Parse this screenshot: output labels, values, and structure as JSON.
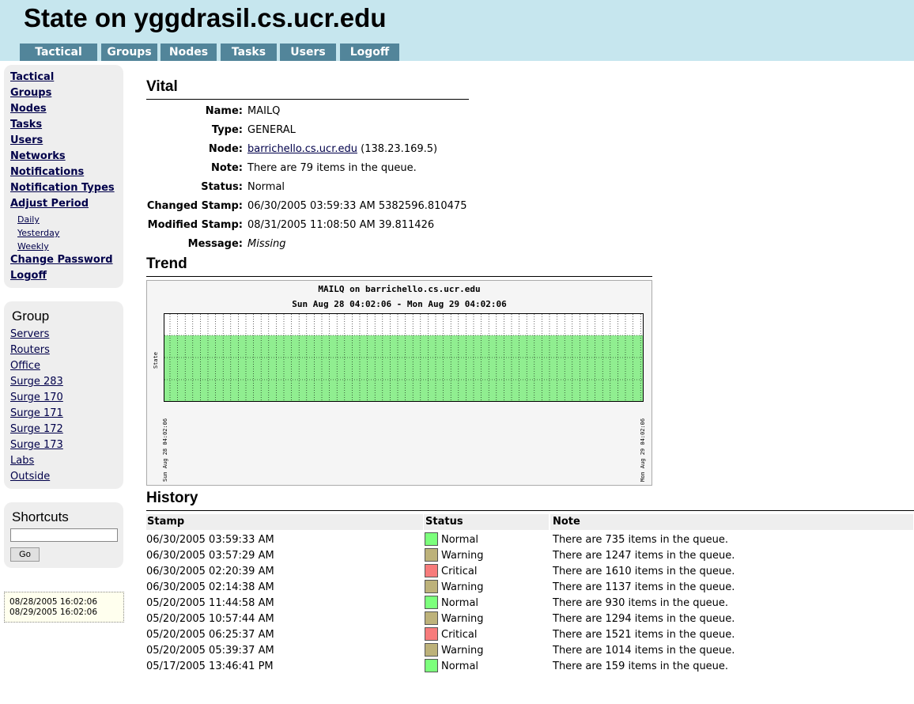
{
  "header": {
    "title": "State on yggdrasil.cs.ucr.edu",
    "tabs": [
      "Tactical",
      "Groups",
      "Nodes",
      "Tasks",
      "Users",
      "Logoff"
    ]
  },
  "sidebar": {
    "nav": [
      "Tactical",
      "Groups",
      "Nodes",
      "Tasks",
      "Users",
      "Networks",
      "Notifications",
      "Notification Types",
      "Adjust Period"
    ],
    "period": [
      "Daily",
      "Yesterday",
      "Weekly"
    ],
    "nav_bottom": [
      "Change Password",
      "Logoff"
    ],
    "group_title": "Group",
    "groups": [
      "Servers",
      "Routers",
      "Office",
      "Surge 283",
      "Surge 170",
      "Surge 171",
      "Surge 172",
      "Surge 173",
      "Labs",
      "Outside"
    ],
    "shortcuts_title": "Shortcuts",
    "shortcut_value": "",
    "go_label": "Go",
    "range_start": "08/28/2005 16:02:06",
    "range_end": "08/29/2005 16:02:06"
  },
  "vital": {
    "title": "Vital",
    "labels": [
      "Name:",
      "Type:",
      "Node:",
      "Note:",
      "Status:",
      "Changed Stamp:",
      "Modified Stamp:",
      "Message:"
    ],
    "name": "MAILQ",
    "type": "GENERAL",
    "node_link": "barrichello.cs.ucr.edu",
    "node_ip": "(138.23.169.5)",
    "note": "There are 79 items in the queue.",
    "status": "Normal",
    "changed": "06/30/2005 03:59:33 AM 5382596.810475",
    "modified": "08/31/2005 11:08:50 AM 39.811426",
    "message": "Missing"
  },
  "trend": {
    "title": "Trend",
    "chart_title": "MAILQ on barrichello.cs.ucr.edu",
    "chart_range": "Sun Aug 28 04:02:06 - Mon Aug 29 04:02:06",
    "ylabel": "State",
    "x_start": "Sun Aug 28 04:02:06",
    "x_end": "Mon Aug 29 04:02:06",
    "fill_color": "#90ee90",
    "state_fraction": 0.75
  },
  "history": {
    "title": "History",
    "columns": [
      "Stamp",
      "Status",
      "Note"
    ],
    "rows": [
      {
        "stamp": "06/30/2005 03:59:33 AM",
        "status": "Normal",
        "note": "There are 735 items in the queue."
      },
      {
        "stamp": "06/30/2005 03:57:29 AM",
        "status": "Warning",
        "note": "There are 1247 items in the queue."
      },
      {
        "stamp": "06/30/2005 02:20:39 AM",
        "status": "Critical",
        "note": "There are 1610 items in the queue."
      },
      {
        "stamp": "06/30/2005 02:14:38 AM",
        "status": "Warning",
        "note": "There are 1137 items in the queue."
      },
      {
        "stamp": "05/20/2005 11:44:58 AM",
        "status": "Normal",
        "note": "There are 930 items in the queue."
      },
      {
        "stamp": "05/20/2005 10:57:44 AM",
        "status": "Warning",
        "note": "There are 1294 items in the queue."
      },
      {
        "stamp": "05/20/2005 06:25:37 AM",
        "status": "Critical",
        "note": "There are 1521 items in the queue."
      },
      {
        "stamp": "05/20/2005 05:39:37 AM",
        "status": "Warning",
        "note": "There are 1014 items in the queue."
      },
      {
        "stamp": "05/17/2005 13:46:41 PM",
        "status": "Normal",
        "note": "There are 159 items in the queue."
      }
    ],
    "status_colors": {
      "Normal": "#7cff7c",
      "Warning": "#bdb27a",
      "Critical": "#f77b7b"
    }
  },
  "colors": {
    "header_bg": "#c6e6ee",
    "tab_bg": "#52859a",
    "link": "#00004a"
  }
}
